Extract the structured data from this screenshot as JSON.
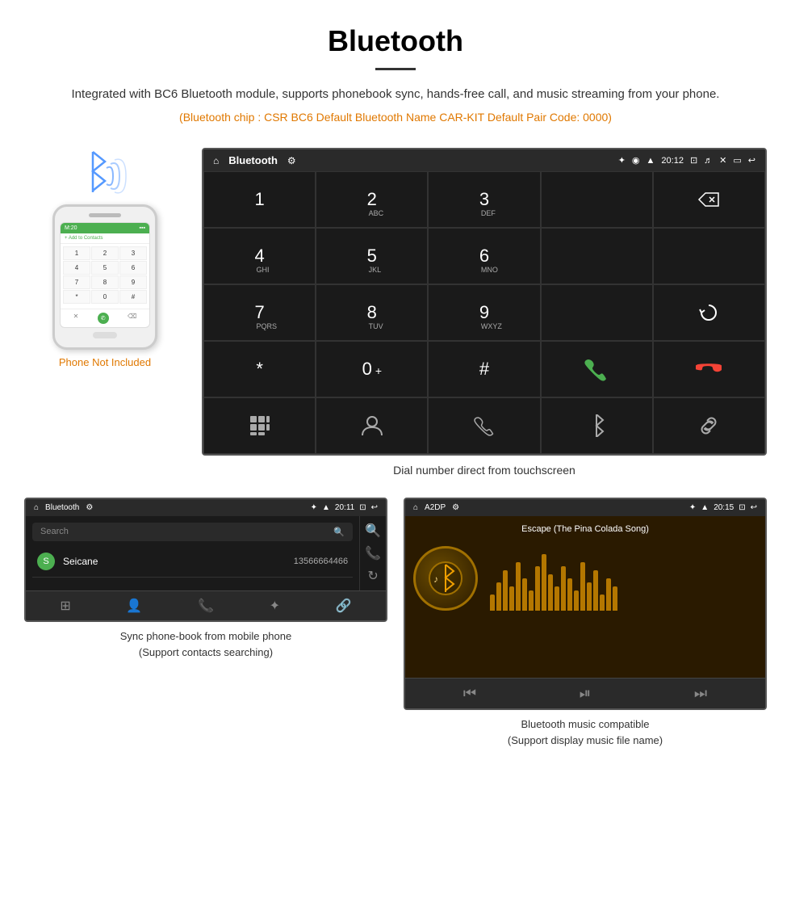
{
  "header": {
    "title": "Bluetooth",
    "description": "Integrated with BC6 Bluetooth module, supports phonebook sync, hands-free call, and music streaming from your phone.",
    "specs": "(Bluetooth chip : CSR BC6    Default Bluetooth Name CAR-KIT    Default Pair Code: 0000)"
  },
  "phone_section": {
    "not_included_label": "Phone Not Included"
  },
  "large_screen": {
    "statusbar_title": "Bluetooth",
    "statusbar_time": "20:12",
    "dialpad": {
      "keys": [
        {
          "num": "1",
          "sub": ""
        },
        {
          "num": "2",
          "sub": "ABC"
        },
        {
          "num": "3",
          "sub": "DEF"
        },
        {
          "num": "4",
          "sub": "GHI"
        },
        {
          "num": "5",
          "sub": "JKL"
        },
        {
          "num": "6",
          "sub": "MNO"
        },
        {
          "num": "7",
          "sub": "PQRS"
        },
        {
          "num": "8",
          "sub": "TUV"
        },
        {
          "num": "9",
          "sub": "WXYZ"
        },
        {
          "num": "*",
          "sub": ""
        },
        {
          "num": "0",
          "sub": "+"
        },
        {
          "num": "#",
          "sub": ""
        }
      ]
    },
    "caption": "Dial number direct from touchscreen"
  },
  "phonebook_screen": {
    "statusbar_title": "Bluetooth",
    "statusbar_time": "20:11",
    "search_placeholder": "Search",
    "contact": {
      "letter": "S",
      "name": "Seicane",
      "number": "13566664466"
    },
    "caption_line1": "Sync phone-book from mobile phone",
    "caption_line2": "(Support contacts searching)"
  },
  "music_screen": {
    "statusbar_title": "A2DP",
    "statusbar_time": "20:15",
    "song_title": "Escape (The Pina Colada Song)",
    "caption_line1": "Bluetooth music compatible",
    "caption_line2": "(Support display music file name)"
  },
  "watermark": "Seicane"
}
